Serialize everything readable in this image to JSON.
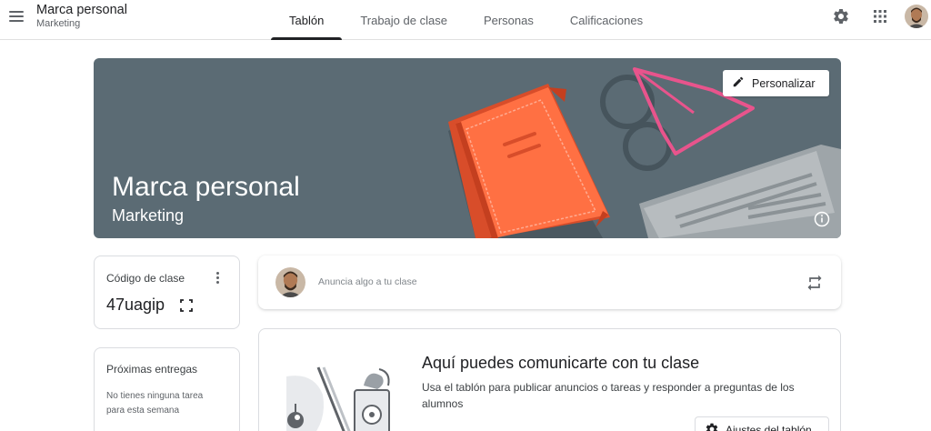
{
  "header": {
    "class_name": "Marca personal",
    "class_section": "Marketing",
    "tabs": [
      {
        "label": "Tablón",
        "active": true
      },
      {
        "label": "Trabajo de clase",
        "active": false
      },
      {
        "label": "Personas",
        "active": false
      },
      {
        "label": "Calificaciones",
        "active": false
      }
    ],
    "icons": [
      "menu-icon",
      "gear-icon",
      "apps-grid-icon",
      "avatar"
    ]
  },
  "banner": {
    "title": "Marca personal",
    "subtitle": "Marketing",
    "customize_label": "Personalizar",
    "background_color": "#5b6b74"
  },
  "class_code": {
    "label": "Código de clase",
    "value": "47uagip"
  },
  "upcoming": {
    "title": "Próximas entregas",
    "empty_text": "No tienes ninguna tarea para esta semana"
  },
  "announce": {
    "placeholder": "Anuncia algo a tu clase"
  },
  "welcome": {
    "title": "Aquí puedes comunicarte con tu clase",
    "description": "Usa el tablón para publicar anuncios o tareas y responder a preguntas de los alumnos",
    "settings_label": "Ajustes del tablón"
  },
  "colors": {
    "accent_text": "#202124",
    "book_orange": "#ff7043",
    "glasses_pink": "#e8548c"
  }
}
